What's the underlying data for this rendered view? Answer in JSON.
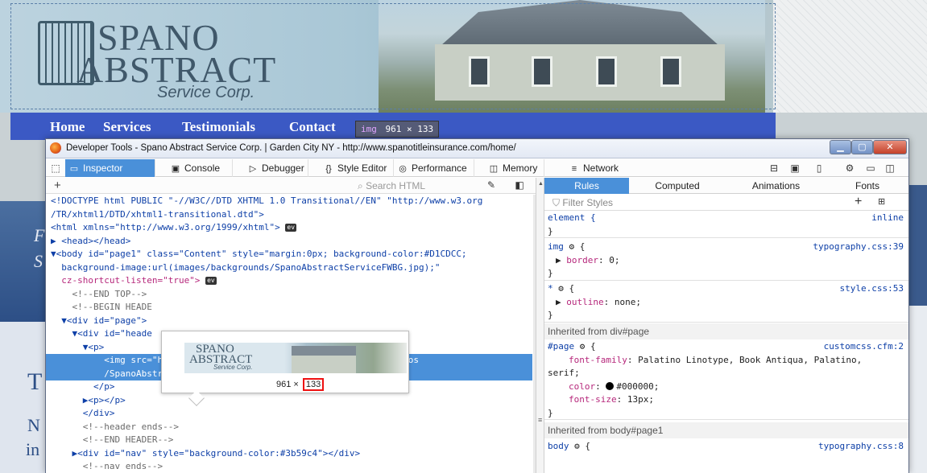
{
  "site": {
    "logo": {
      "line1": "SPANO",
      "line2": "ABSTRACT",
      "line3": "Service Corp."
    },
    "nav": [
      "Home",
      "Services",
      "Testimonials",
      "Contact"
    ],
    "badge": {
      "tag": "img",
      "dims": "961 × 133"
    },
    "side_left_letters": [
      "F",
      "S"
    ],
    "below_left_letters": [
      "T",
      "N",
      "in"
    ]
  },
  "devtools": {
    "window_title": "Developer Tools - Spano Abstract Service Corp. | Garden City NY - http://www.spanotitleinsurance.com/home/",
    "tabs": [
      {
        "label": "Inspector",
        "icon": "▭"
      },
      {
        "label": "Console",
        "icon": "▣"
      },
      {
        "label": "Debugger",
        "icon": "▷"
      },
      {
        "label": "Style Editor",
        "icon": "{}"
      },
      {
        "label": "Performance",
        "icon": "◎"
      },
      {
        "label": "Memory",
        "icon": "◫"
      },
      {
        "label": "Network",
        "icon": "≡"
      }
    ],
    "search_placeholder": "Search HTML",
    "html_lines": [
      "<!DOCTYPE html PUBLIC \"-//W3C//DTD XHTML 1.0 Transitional//EN\" \"http://www.w3.org",
      "/TR/xhtml1/DTD/xhtml1-transitional.dtd\">",
      "<html xmlns=\"http://www.w3.org/1999/xhtml\">",
      "▶ <head></head>",
      "▼<body id=\"page1\" class=\"Content\" style=\"margin:0px; background-color:#D1CDCC;",
      "  background-image:url(images/backgrounds/SpanoAbstractServiceFWBG.jpg);\"",
      "  cz-shortcut-listen=\"true\">",
      "    <!--END TOP-->",
      "    <!--BEGIN HEADE",
      "  ▼<div id=\"page\">",
      "    ▼<div id=\"heade",
      "      ▼<p>",
      "          <img src=\"http://www.ipagepro.com/spanotitleinsurance/logos",
      "          /SpanoAbstractHDR.jpg\" alt=\"Spano Abstract Service\">",
      "        </p>",
      "      ▶<p></p>",
      "      </div>",
      "      <!--header ends-->",
      "      <!--END HEADER-->",
      "    ▶<div id=\"nav\" style=\"background-color:#3b59c4\"></div>",
      "      <!--nav ends-->"
    ],
    "tooltip": {
      "width": "961",
      "height": "133",
      "sep": " × "
    },
    "right_tabs": [
      "Rules",
      "Computed",
      "Animations",
      "Fonts"
    ],
    "filter_placeholder": "Filter Styles",
    "rules": {
      "element": {
        "selector": "element {",
        "source": "inline",
        "close": "}"
      },
      "img": {
        "selector": "img",
        "source": "typography.css:39",
        "prop": "border",
        "value": "0;"
      },
      "star": {
        "selector": "*",
        "source": "style.css:53",
        "prop": "outline",
        "value": "none;"
      },
      "inherit1": "Inherited from div#page",
      "page": {
        "selector": "#page",
        "source": "customcss.cfm:2",
        "font_family_prop": "font-family",
        "font_family_value": "Palatino Linotype, Book Antiqua, Palatino,",
        "font_family_cont": "serif;",
        "color_prop": "color",
        "color_value": "#000000;",
        "size_prop": "font-size",
        "size_value": "13px;"
      },
      "inherit2": "Inherited from body#page1",
      "body": {
        "selector": "body",
        "source": "typography.css:8"
      }
    }
  }
}
